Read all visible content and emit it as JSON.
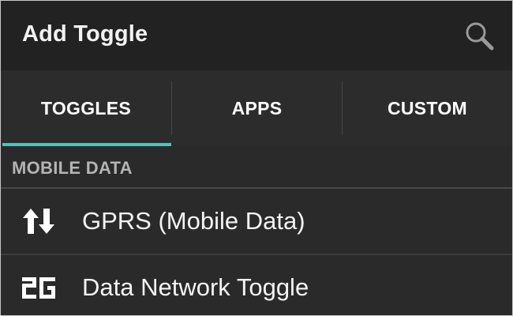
{
  "header": {
    "title": "Add Toggle",
    "search_icon": "search-icon"
  },
  "tabs": [
    {
      "label": "TOGGLES",
      "selected": true
    },
    {
      "label": "APPS",
      "selected": false
    },
    {
      "label": "CUSTOM",
      "selected": false
    }
  ],
  "colors": {
    "tab_indicator": "#56c0b9",
    "background": "#2a2a2a",
    "action_bar": "#222222"
  },
  "section": {
    "label": "MOBILE DATA"
  },
  "items": [
    {
      "label": "GPRS (Mobile Data)",
      "icon": "up-down-arrows-icon"
    },
    {
      "label": "Data Network Toggle",
      "icon": "2g-icon"
    }
  ]
}
